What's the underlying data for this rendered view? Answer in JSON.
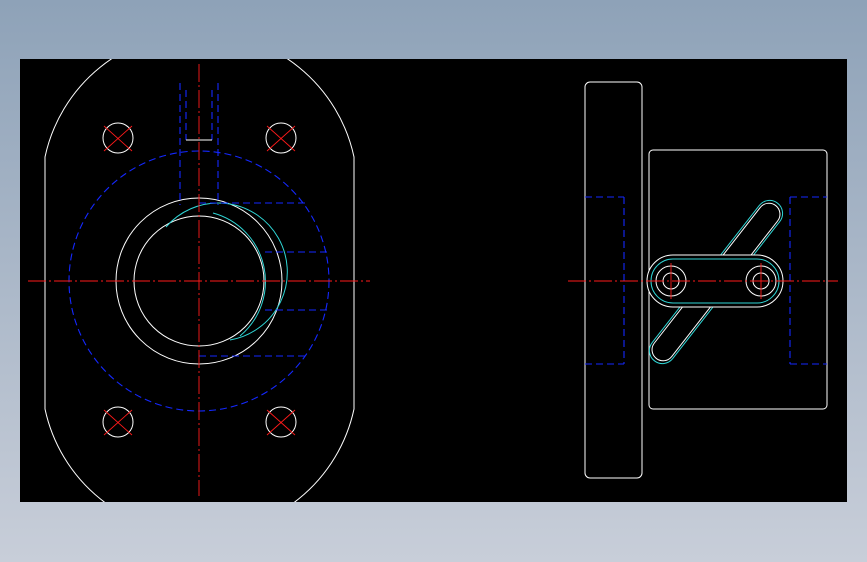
{
  "background": {
    "gradient_top": "#8ea2b8",
    "gradient_bottom": "#c8ced9"
  },
  "drawing": {
    "background": "#000000",
    "colors": {
      "outline": "#ffffff",
      "centerline": "#ff1a1a",
      "hidden_line": "#1428ff",
      "thread": "#2fd6d6"
    },
    "views": [
      "front-view",
      "side-view"
    ]
  }
}
